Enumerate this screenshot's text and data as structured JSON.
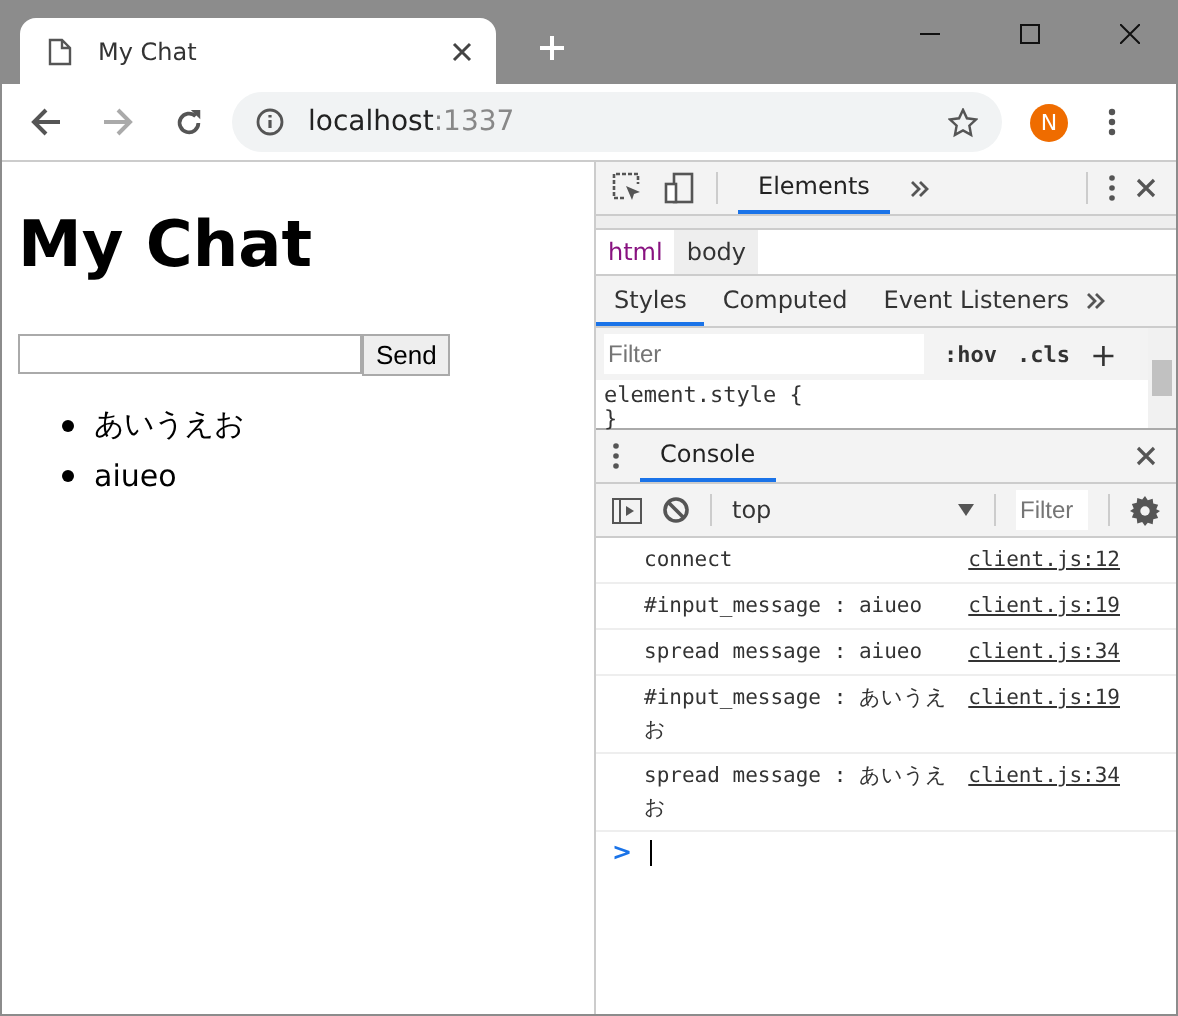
{
  "browser_tab": {
    "title": "My Chat"
  },
  "address_bar": {
    "host": "localhost",
    "port": ":1337",
    "avatar_letter": "N"
  },
  "page": {
    "heading": "My Chat",
    "send_button": "Send",
    "messages": [
      "あいうえお",
      "aiueo"
    ]
  },
  "devtools": {
    "top_tabs": [
      {
        "label": "Elements",
        "selected": true
      }
    ],
    "breadcrumbs": [
      {
        "label": "html",
        "selected": false
      },
      {
        "label": "body",
        "selected": true
      }
    ],
    "style_tabs": [
      {
        "label": "Styles",
        "selected": true
      },
      {
        "label": "Computed",
        "selected": false
      },
      {
        "label": "Event Listeners",
        "selected": false
      }
    ],
    "styles_filter": {
      "placeholder": "Filter"
    },
    "hov": ":hov",
    "cls": ".cls",
    "plus": "+",
    "style_rule": [
      "element.style {",
      "}"
    ],
    "drawer_tabs": [
      {
        "label": "Console",
        "selected": true
      }
    ],
    "context": "top",
    "console_filter": {
      "placeholder": "Filter"
    },
    "console_lines": [
      {
        "text": "connect",
        "source": "client.js:12"
      },
      {
        "text": "#input_message : aiueo",
        "source": "client.js:19"
      },
      {
        "text": "spread message : aiueo",
        "source": "client.js:34"
      },
      {
        "text": "#input_message : あいうえお",
        "source": "client.js:19"
      },
      {
        "text": "spread message : あいうえお",
        "source": "client.js:34"
      }
    ],
    "prompt": ">"
  }
}
